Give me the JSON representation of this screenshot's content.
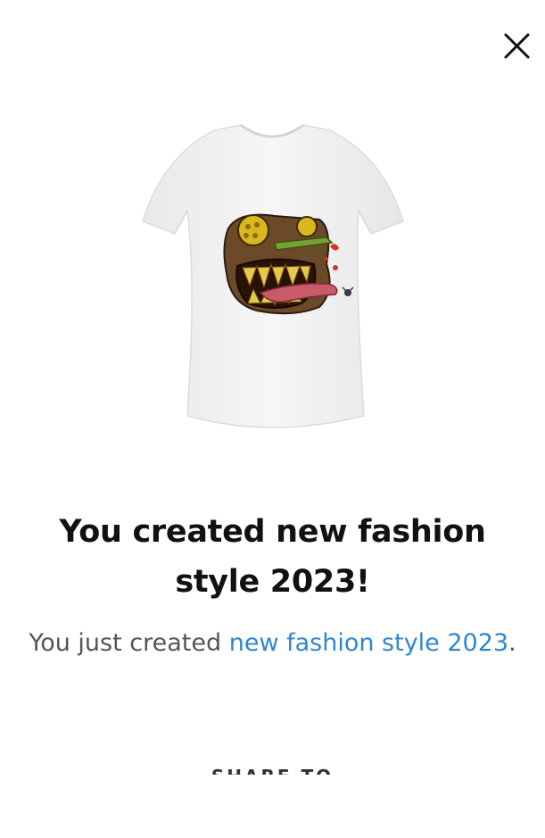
{
  "close": {
    "icon": "close-icon"
  },
  "product": {
    "image_description": "white t-shirt with monster print"
  },
  "headline": "You created new fashion style 2023!",
  "subtext": {
    "prefix": "You just created ",
    "link_text": "new fashion style 2023",
    "suffix": "."
  },
  "share": {
    "label": "SHARE TO"
  },
  "colors": {
    "link": "#2f86d0",
    "heading": "#111111",
    "body_text": "#555555"
  }
}
